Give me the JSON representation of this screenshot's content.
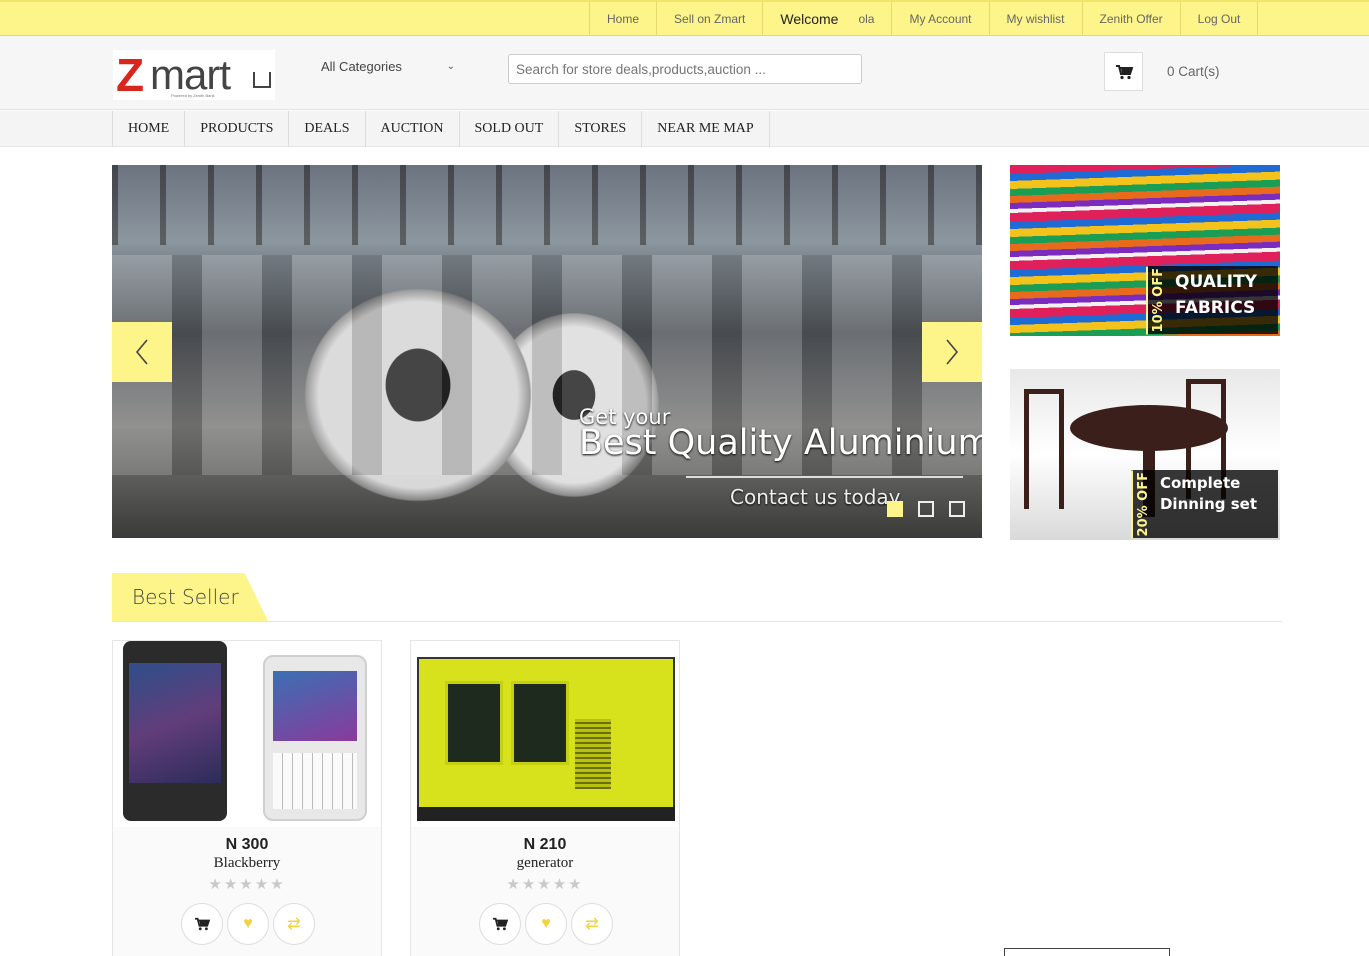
{
  "topbar": {
    "links": [
      "Home",
      "Sell on Zmart"
    ],
    "welcome": "Welcome",
    "user": "ola",
    "links2": [
      "My Account",
      "My wishlist",
      "Zenith Offer",
      "Log Out"
    ]
  },
  "header": {
    "logo_main": "Z",
    "logo_rest": "mart",
    "logo_tagline": "Powered by Zenith Bank",
    "category": "All Categories",
    "search_placeholder": "Search for store deals,products,auction ...",
    "cart_text": "0 Cart(s)"
  },
  "nav": [
    "HOME",
    "PRODUCTS",
    "DEALS",
    "AUCTION",
    "SOLD OUT",
    "STORES",
    "NEAR ME MAP"
  ],
  "slider": {
    "caption_small": "Get your",
    "caption_big": "Best Quality Aluminium",
    "caption_sub": "Contact us today",
    "dots": 3,
    "active_dot": 0
  },
  "banners": [
    {
      "off": "10% OFF",
      "line1": "QUALITY",
      "line2": "FABRICS"
    },
    {
      "off": "20% OFF",
      "line1": "Complete",
      "line2": "Dinning set"
    }
  ],
  "best_seller": {
    "title": "Best Seller",
    "products": [
      {
        "price": "N 300",
        "name": "Blackberry",
        "stars": "★★★★★"
      },
      {
        "price": "N 210",
        "name": "generator",
        "stars": "★★★★★"
      }
    ]
  },
  "colors": {
    "accent": "#fdf48a",
    "brand_red": "#d9261c"
  },
  "icons": {
    "cart": "cart-icon",
    "wishlist": "heart-icon",
    "compare": "swap-icon",
    "prev": "chevron-left-icon",
    "next": "chevron-right-icon"
  }
}
